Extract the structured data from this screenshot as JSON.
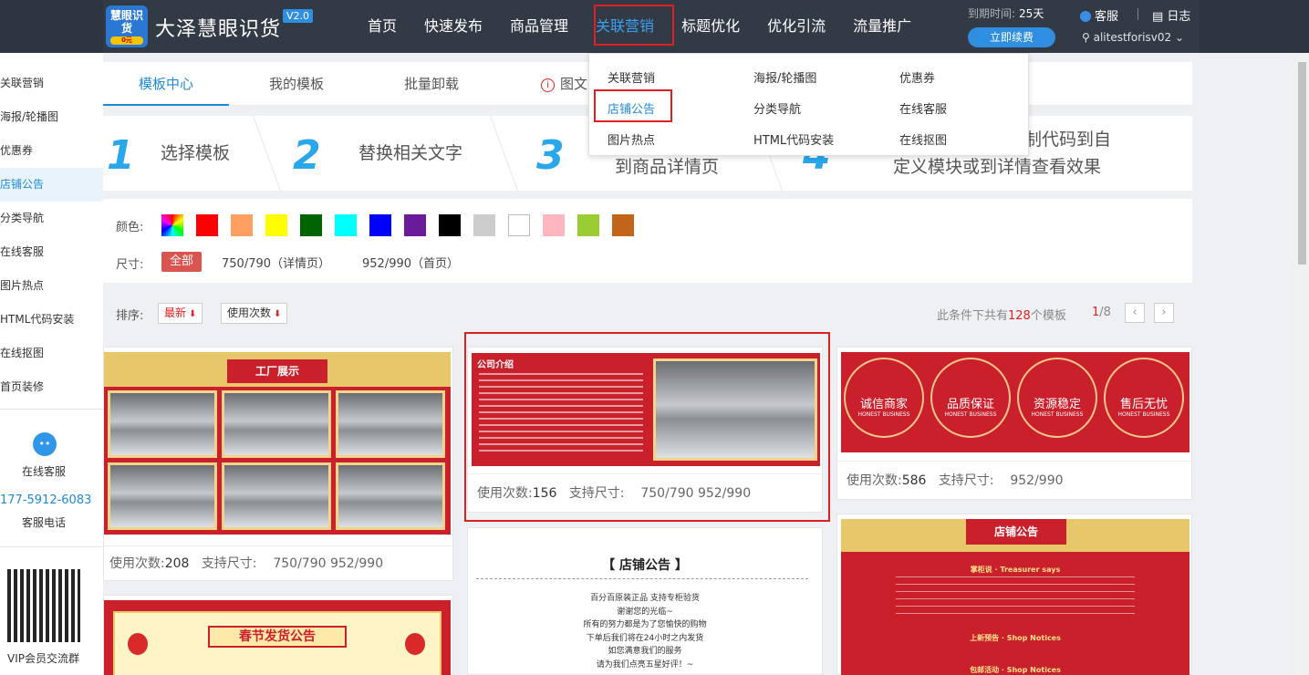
{
  "header": {
    "logo_text": "慧眼识货",
    "logo_tag": "0元",
    "brand": "大泽慧眼识货",
    "version": "V2.0",
    "nav": [
      "首页",
      "快速发布",
      "商品管理",
      "关联营销",
      "标题优化",
      "优化引流",
      "流量推广"
    ],
    "expire_label": "到期时间:",
    "expire_value": "25天",
    "renew_label": "立即续费",
    "service_label": "客服",
    "log_label": "日志",
    "username": "alitestforisv02"
  },
  "dropdown": {
    "items": [
      "关联营销",
      "海报/轮播图",
      "优惠券",
      "店铺公告",
      "分类导航",
      "在线客服",
      "图片热点",
      "HTML代码安装",
      "在线抠图"
    ]
  },
  "sidebar": {
    "items": [
      "关联营销",
      "海报/轮播图",
      "优惠券",
      "店铺公告",
      "分类导航",
      "在线客服",
      "图片热点",
      "HTML代码安装",
      "在线抠图",
      "首页装修"
    ],
    "cs_label": "在线客服",
    "phone": "177-5912-6083",
    "phone_label": "客服电话",
    "qr_label": "VIP会员交流群"
  },
  "tabs": [
    "模板中心",
    "我的模板",
    "批量卸载",
    "图文"
  ],
  "steps": [
    {
      "num": "1",
      "text": "选择模板"
    },
    {
      "num": "2",
      "text": "替换相关文字"
    },
    {
      "num": "3",
      "text": "到商品详情页"
    },
    {
      "num": "4",
      "text_line1": "制代码到自",
      "text_line2": "定义模块或到详情查看效果"
    }
  ],
  "filters": {
    "color_label": "颜色:",
    "colors": [
      "rainbow",
      "#ff0000",
      "#ff9f60",
      "#ffff00",
      "#006400",
      "#00ffff",
      "#0000ff",
      "#6a1b9a",
      "#000000",
      "#cccccc",
      "#ffffff",
      "#ffb6c1",
      "#9acd32",
      "#c2651a"
    ],
    "size_label": "尺寸:",
    "size_all": "全部",
    "size_opts": [
      "750/790（详情页）",
      "952/990（首页）"
    ]
  },
  "sort": {
    "label": "排序:",
    "newest": "最新",
    "usage": "使用次数",
    "count_prefix": "此条件下共有",
    "count": "128",
    "count_suffix": "个模板",
    "page_current": "1",
    "page_total": "/8"
  },
  "cards": [
    {
      "title": "工厂展示",
      "uses_label": "使用次数:",
      "uses": "208",
      "size_label": "支持尺寸:",
      "sizes": "750/790   952/990"
    },
    {
      "title": "公司介绍",
      "uses_label": "使用次数:",
      "uses": "156",
      "size_label": "支持尺寸:",
      "sizes": "750/790   952/990"
    },
    {
      "badges": [
        "诚信商家",
        "品质保证",
        "资源稳定",
        "售后无忧"
      ],
      "badge_sub": "HONEST BUSINESS",
      "uses_label": "使用次数:",
      "uses": "586",
      "size_label": "支持尺寸:",
      "sizes": "952/990"
    },
    {
      "title": "【 店铺公告 】",
      "lines": [
        "百分百原装正品 支持专柜验货",
        "谢谢您的光临~",
        "所有的努力都是为了您愉快的购物",
        "下单后我们将在24小时之内发货",
        "如您满意我们的服务",
        "请为我们点亮五星好评！~"
      ]
    },
    {
      "title": "店铺公告",
      "line1": "掌柜说 · Treasurer says",
      "line2": "上新预告 · Shop Notices",
      "line3": "包邮活动 · Shop Notices"
    },
    {
      "title": "春节发货公告"
    }
  ]
}
